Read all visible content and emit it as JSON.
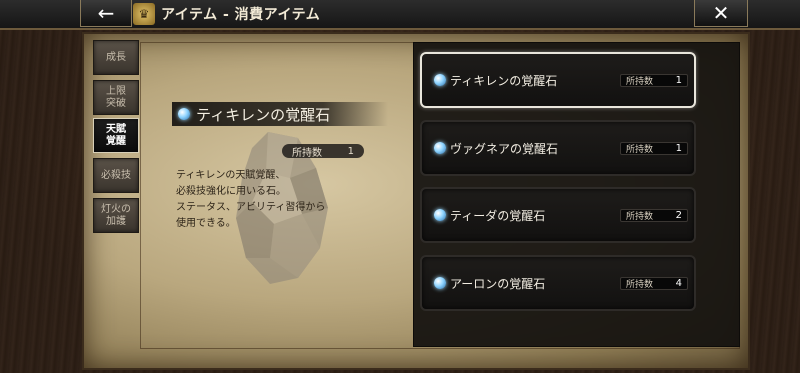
{
  "header": {
    "back_icon": "arrow-left-icon",
    "title": "アイテム - 消費アイテム",
    "emblem_icon": "gold-emblem-icon",
    "close_icon": "close-icon"
  },
  "tabs": [
    {
      "label": "成長",
      "active": false
    },
    {
      "label": "上限\n突破",
      "active": false
    },
    {
      "label": "天賦\n覚醒",
      "active": true
    },
    {
      "label": "必殺技",
      "active": false
    },
    {
      "label": "灯火の\n加護",
      "active": false
    }
  ],
  "detail": {
    "name": "ティキレンの覚醒石",
    "count_label": "所持数",
    "count": "1",
    "description": "ティキレンの天賦覚醒、\n必殺技強化に用いる石。\nステータス、アビリティ習得から\n使用できる。"
  },
  "items": [
    {
      "name": "ティキレンの覚醒石",
      "count_label": "所持数",
      "count": "1",
      "selected": true
    },
    {
      "name": "ヴァグネアの覚醒石",
      "count_label": "所持数",
      "count": "1",
      "selected": false
    },
    {
      "name": "ティーダの覚醒石",
      "count_label": "所持数",
      "count": "2",
      "selected": false
    },
    {
      "name": "アーロンの覚醒石",
      "count_label": "所持数",
      "count": "4",
      "selected": false
    }
  ]
}
